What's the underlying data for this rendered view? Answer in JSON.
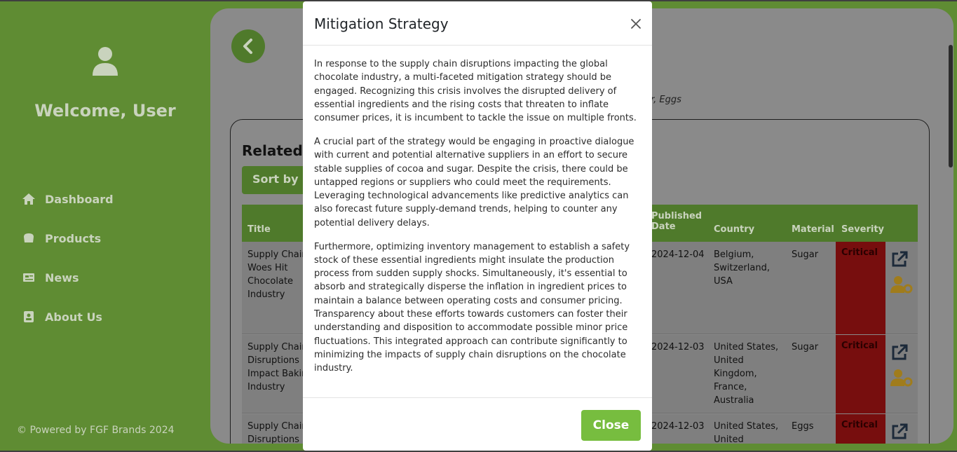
{
  "sidebar": {
    "welcome": "Welcome, User",
    "items": [
      {
        "label": "Dashboard",
        "icon": "home-icon"
      },
      {
        "label": "Products",
        "icon": "products-icon"
      },
      {
        "label": "News",
        "icon": "news-icon"
      },
      {
        "label": "About Us",
        "icon": "about-icon"
      }
    ],
    "footer": "© Powered by FGF Brands 2024"
  },
  "main": {
    "subtitle": "er, Eggs",
    "related_title": "Related",
    "sort_label": "Sort by P",
    "columns": {
      "title": "Title",
      "published_line1": "Published",
      "published_line2": "Date",
      "country": "Country",
      "material": "Material",
      "severity": "Severity"
    },
    "rows": [
      {
        "title": [
          "Supply Chain",
          "Woes Hit",
          "Chocolate",
          "Industry"
        ],
        "date": "2024-12-04",
        "country": [
          "Belgium,",
          "Switzerland,",
          "USA"
        ],
        "material": "Sugar",
        "severity": "Critical"
      },
      {
        "title": [
          "Supply Chain",
          "Disruptions",
          "Impact Bakin",
          "Industry"
        ],
        "date": "2024-12-03",
        "country": [
          "United States,",
          "United",
          "Kingdom,",
          "France,",
          "Australia"
        ],
        "material": "Sugar",
        "severity": "Critical"
      },
      {
        "title": [
          "Supply Chain",
          "Disruptions"
        ],
        "date": "2024-12-03",
        "country": [
          "United States,",
          "United"
        ],
        "material": "Eggs",
        "severity": "Critical"
      }
    ]
  },
  "modal": {
    "title": "Mitigation Strategy",
    "paragraphs": [
      "In response to the supply chain disruptions impacting the global chocolate industry, a multi-faceted mitigation strategy should be engaged. Recognizing this crisis involves the disrupted delivery of essential ingredients and the rising costs that threaten to inflate consumer prices, it is incumbent to tackle the issue on multiple fronts.",
      "A crucial part of the strategy would be engaging in proactive dialogue with current and potential alternative suppliers in an effort to secure stable supplies of cocoa and sugar. Despite the crisis, there could be untapped regions or suppliers who could meet the requirements. Leveraging technological advancements like predictive analytics can also forecast future supply-demand trends, helping to counter any potential delivery delays.",
      "Furthermore, optimizing inventory management to establish a safety stock of these essential ingredients might insulate the production process from sudden supply shocks. Simultaneously, it's essential to absorb and strategically disperse the inflation in ingredient prices to maintain a balance between operating costs and consumer pricing. Transparency about these efforts towards customers can foster their understanding and disposition to accommodate possible minor price fluctuations. This integrated approach can contribute significantly to minimizing the impacts of supply chain disruptions on the chocolate industry."
    ],
    "close_label": "Close"
  },
  "colors": {
    "sidebar_bg": "#5f8c33",
    "accent": "#77bd3f",
    "critical": "#770e0e"
  }
}
